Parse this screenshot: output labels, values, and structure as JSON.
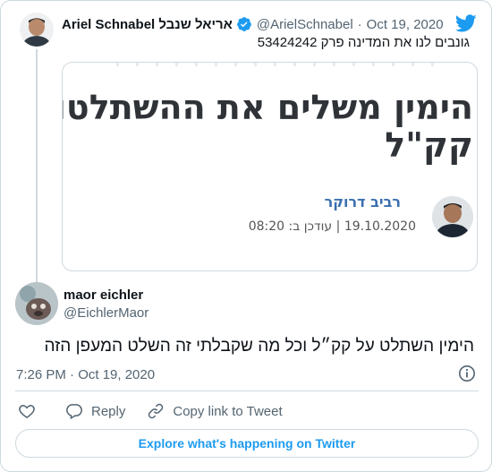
{
  "parent_tweet": {
    "display_name": "Ariel Schnabel אריאל שנבל",
    "handle": "@ArielSchnabel",
    "separator": "·",
    "date": "Oct 19, 2020",
    "text": "גונבים לנו את המדינה פרק 53424242",
    "photo": {
      "headline_line1": "הימין משלים את ההשתלטות על",
      "headline_line2": "קק\"ל",
      "author": "רביב דרוקר",
      "meta": "19.10.2020 | עודכן ב: 08:20"
    }
  },
  "reply_tweet": {
    "display_name": "maor eichler",
    "handle": "@EichlerMaor",
    "text": "הימין השתלט על קק״ל וכל מה שקבלתי זה השלט המעפן הזה",
    "timestamp": "7:26 PM · Oct 19, 2020"
  },
  "actions": {
    "reply": "Reply",
    "copy_link": "Copy link to Tweet"
  },
  "explore_button": "Explore what's happening on Twitter",
  "colors": {
    "twitter_blue": "#1d9bf0",
    "muted_text": "#536471",
    "border": "#cfd9de"
  },
  "icons": [
    "twitter-logo-icon",
    "verified-badge-icon",
    "info-icon",
    "heart-icon",
    "reply-icon",
    "link-icon"
  ]
}
